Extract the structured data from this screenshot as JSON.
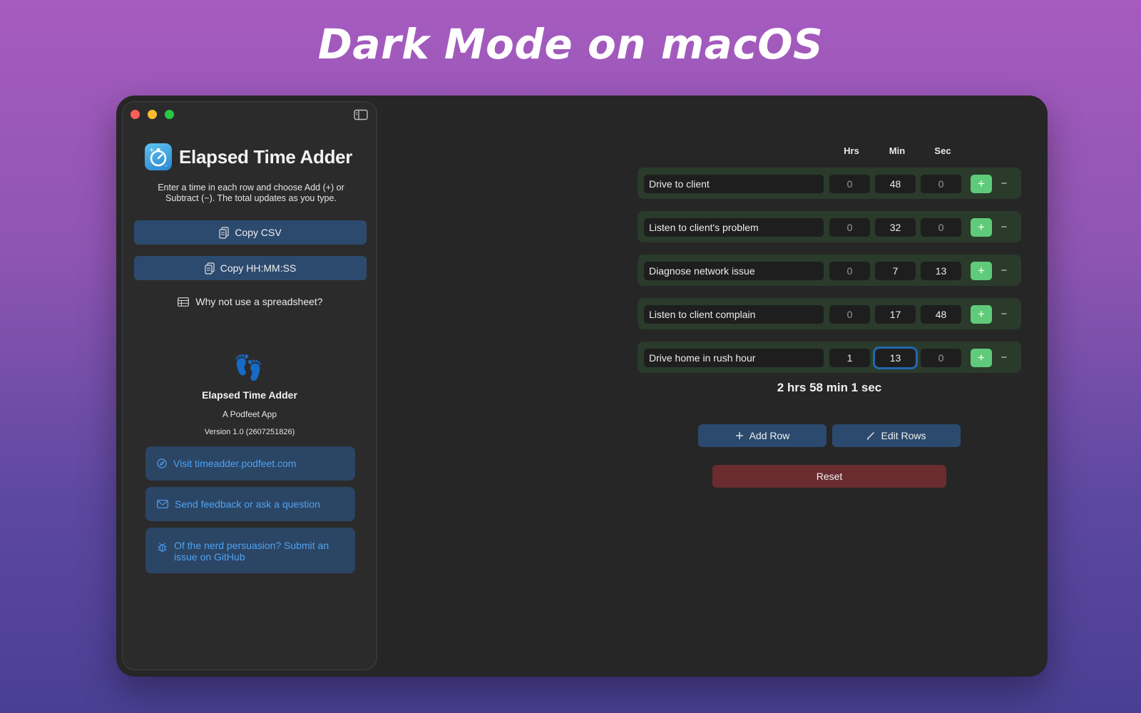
{
  "headline": "Dark Mode on macOS",
  "sidebar": {
    "app_title": "Elapsed Time Adder",
    "intro": "Enter a time in each row and choose Add (+) or Subtract (−). The total updates as you type.",
    "copy_csv": "Copy CSV",
    "copy_hms": "Copy HH:MM:SS",
    "why_spreadsheet": "Why not use a spreadsheet?",
    "about_name": "Elapsed Time Adder",
    "about_sub": "A Podfeet App",
    "about_version": "Version 1.0 (2607251826)",
    "links": [
      {
        "label": "Visit timeadder.podfeet.com",
        "icon": "compass-icon"
      },
      {
        "label": "Send feedback or ask a question",
        "icon": "envelope-icon"
      },
      {
        "label": "Of the nerd persuasion? Submit an issue on GitHub",
        "icon": "bug-icon"
      }
    ]
  },
  "main": {
    "columns": {
      "hrs": "Hrs",
      "min": "Min",
      "sec": "Sec"
    },
    "rows": [
      {
        "label": "Drive to client",
        "hrs": "0",
        "min": "48",
        "sec": "0"
      },
      {
        "label": "Listen to client's problem",
        "hrs": "0",
        "min": "32",
        "sec": "0"
      },
      {
        "label": "Diagnose network issue",
        "hrs": "0",
        "min": "7",
        "sec": "13"
      },
      {
        "label": "Listen to client complain",
        "hrs": "0",
        "min": "17",
        "sec": "48"
      },
      {
        "label": "Drive home in rush hour",
        "hrs": "1",
        "min": "13",
        "sec": "0"
      }
    ],
    "plus_label": "+",
    "minus_label": "−",
    "total": "2 hrs 58 min 1 sec",
    "add_row": "Add Row",
    "edit_rows": "Edit Rows",
    "reset": "Reset"
  },
  "colors": {
    "accent_blue": "#2c4a6e",
    "link_blue": "#4fa3f2",
    "plus_green": "#5fcb7a",
    "reset_red": "#6a2c2f",
    "row_bg": "#2a3a2b"
  }
}
